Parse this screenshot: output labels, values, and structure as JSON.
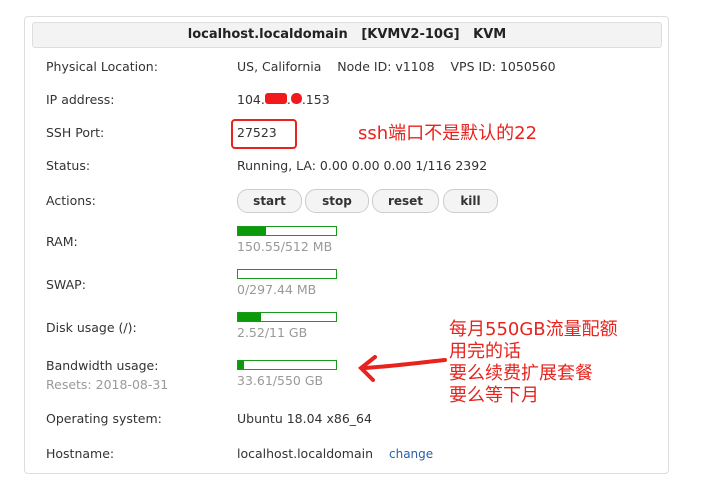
{
  "header": {
    "title": "localhost.localdomain   [KVMV2-10G]   KVM"
  },
  "rows": {
    "location": {
      "label": "Physical Location:",
      "value": "US, California    Node ID: v1108    VPS ID: 1050560"
    },
    "ip": {
      "label": "IP address:",
      "prefix": "104.",
      "suffix": ".153"
    },
    "ssh": {
      "label": "SSH Port:",
      "value": "27523"
    },
    "status": {
      "label": "Status:",
      "value": "Running, LA: 0.00 0.00 0.00 1/116 2392"
    },
    "actions": {
      "label": "Actions:",
      "buttons": [
        "start",
        "stop",
        "reset",
        "kill"
      ]
    },
    "ram": {
      "label": "RAM:",
      "value": "150.55/512 MB",
      "percent": 29
    },
    "swap": {
      "label": "SWAP:",
      "value": "0/297.44 MB",
      "percent": 0
    },
    "disk": {
      "label": "Disk usage (/):",
      "value": "2.52/11 GB",
      "percent": 23
    },
    "bandwidth": {
      "label": "Bandwidth usage:",
      "resets": "Resets: 2018-08-31",
      "value": "33.61/550 GB",
      "percent": 6
    },
    "os": {
      "label": "Operating system:",
      "value": "Ubuntu 18.04 x86_64"
    },
    "hostname": {
      "label": "Hostname:",
      "value": "localhost.localdomain",
      "link": "change"
    }
  },
  "annotations": {
    "ssh_note": "ssh端口不是默认的22",
    "bw_note": [
      "每月550GB流量配额",
      "用完的话",
      "要么续费扩展套餐",
      "要么等下月"
    ],
    "color": "#e8231d"
  }
}
